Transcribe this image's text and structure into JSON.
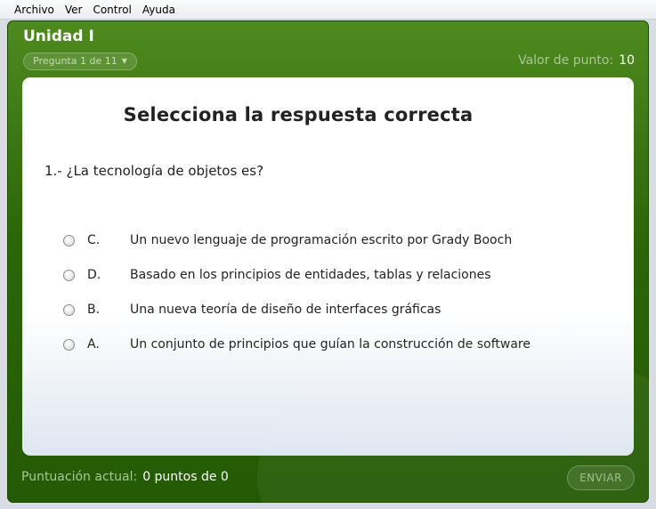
{
  "menu": [
    "Archivo",
    "Ver",
    "Control",
    "Ayuda"
  ],
  "header": {
    "unit_title": "Unidad I",
    "question_selector": "Pregunta 1 de 11",
    "points_label": "Valor de punto:",
    "points_value": "10"
  },
  "card": {
    "heading": "Selecciona la respuesta correcta",
    "question": "1.- ¿La tecnología de objetos es?",
    "options": [
      {
        "letter": "C.",
        "text": "Un nuevo lenguaje de programación escrito por Grady Booch"
      },
      {
        "letter": "D.",
        "text": "Basado en los principios de entidades, tablas y relaciones"
      },
      {
        "letter": "B.",
        "text": "Una nueva teoría de diseño de interfaces gráficas"
      },
      {
        "letter": "A.",
        "text": "Un conjunto de principios que guían la construcción de software"
      }
    ]
  },
  "footer": {
    "score_label": "Puntuación actual:",
    "score_value": "0 puntos de 0",
    "submit_label": "ENVIAR"
  }
}
